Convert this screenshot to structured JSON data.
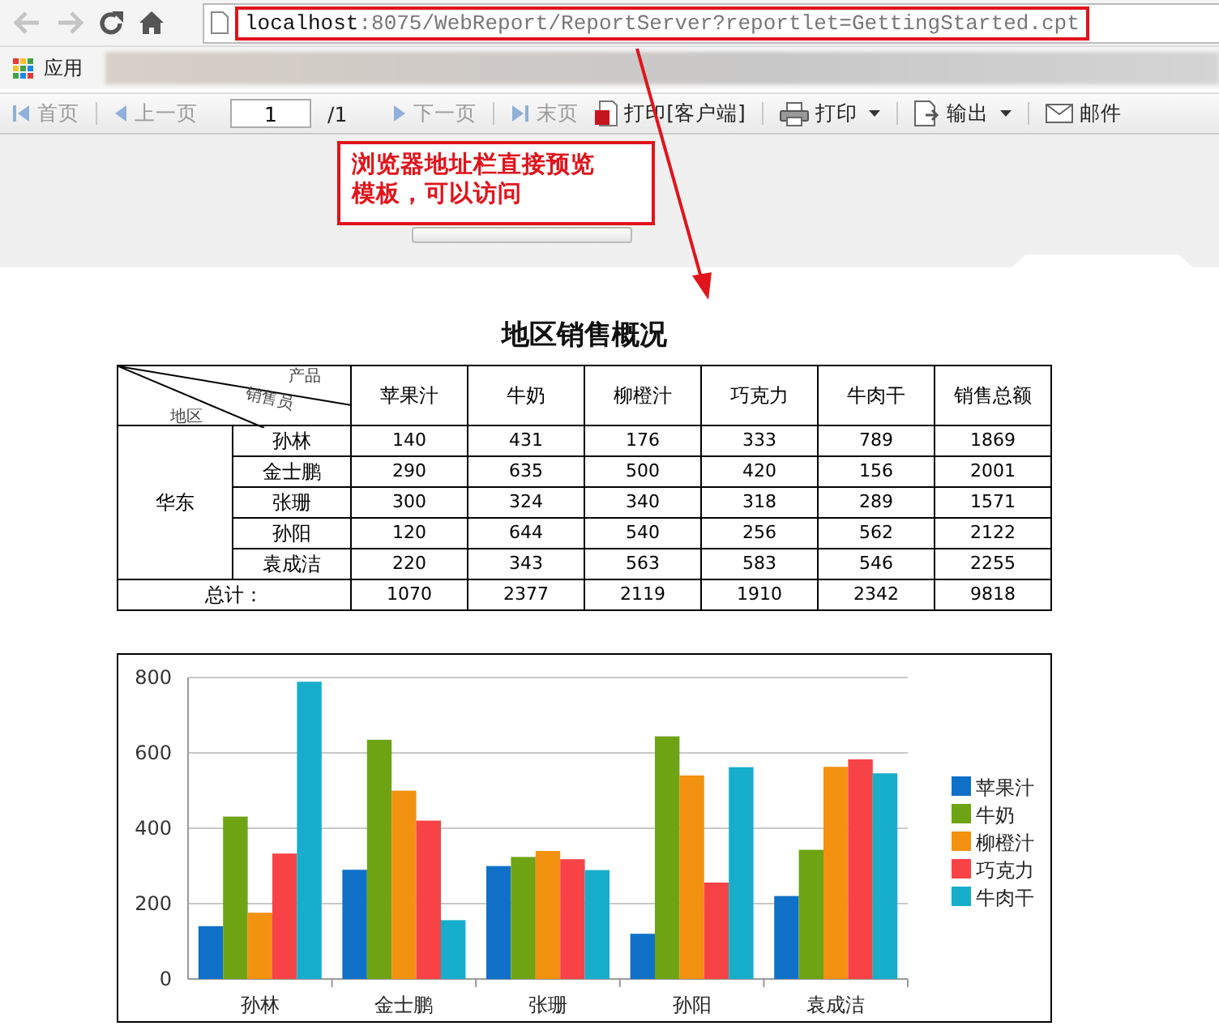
{
  "browser": {
    "url_host": "localhost",
    "url_rest": ":8075/WebReport/ReportServer?reportlet=GettingStarted.cpt",
    "bookmarks": [
      {
        "label": "应用"
      }
    ]
  },
  "toolbar": {
    "buttons": [
      {
        "kind": "first",
        "label": "首页",
        "disabled": true,
        "menu": false
      },
      {
        "kind": "prev",
        "label": "上一页",
        "disabled": true,
        "menu": false
      },
      {
        "kind": "page",
        "total": "/1",
        "value": "1"
      },
      {
        "kind": "next",
        "label": "下一页",
        "disabled": true,
        "menu": false
      },
      {
        "kind": "last",
        "label": "末页",
        "disabled": true,
        "menu": false
      },
      {
        "kind": "pdf",
        "label": "打印[客户端]",
        "disabled": false,
        "menu": false
      },
      {
        "kind": "print",
        "label": "打印",
        "disabled": false,
        "menu": true
      },
      {
        "kind": "export",
        "label": "输出",
        "disabled": false,
        "menu": true
      },
      {
        "kind": "mail",
        "label": "邮件",
        "disabled": false,
        "menu": false
      }
    ]
  },
  "callout": {
    "lines": [
      "浏览器地址栏直接预览",
      "模板，可以访问"
    ]
  },
  "report": {
    "title": "地区销售概况",
    "table": {
      "corner": {
        "top": "产品",
        "middle": "销售员",
        "bottom": "地区"
      },
      "columns": [
        "苹果汁",
        "牛奶",
        "柳橙汁",
        "巧克力",
        "牛肉干",
        "销售总额"
      ],
      "groups": [
        {
          "region": "华东",
          "rows": [
            {
              "name": "孙林",
              "cells": [
                "140",
                "431",
                "176",
                "333",
                "789",
                "1869"
              ]
            },
            {
              "name": "金士鹏",
              "cells": [
                "290",
                "635",
                "500",
                "420",
                "156",
                "2001"
              ]
            },
            {
              "name": "张珊",
              "cells": [
                "300",
                "324",
                "340",
                "318",
                "289",
                "1571"
              ]
            },
            {
              "name": "孙阳",
              "cells": [
                "120",
                "644",
                "540",
                "256",
                "562",
                "2122"
              ]
            },
            {
              "name": "袁成洁",
              "cells": [
                "220",
                "343",
                "563",
                "583",
                "546",
                "2255"
              ]
            }
          ]
        }
      ],
      "total": {
        "label": "总计：",
        "cells": [
          "1070",
          "2377",
          "2119",
          "1910",
          "2342",
          "9818"
        ]
      }
    },
    "chart_data": {
      "type": "bar",
      "categories": [
        "孙林",
        "金士鹏",
        "张珊",
        "孙阳",
        "袁成洁"
      ],
      "ylim": [
        0,
        800
      ],
      "grid": true,
      "legend": true,
      "yticks": [
        0,
        200,
        400,
        600,
        800
      ],
      "series": [
        {
          "name": "苹果汁",
          "color": "#1070c8",
          "values": [
            140,
            290,
            300,
            120,
            220
          ]
        },
        {
          "name": "牛奶",
          "color": "#6ea414",
          "values": [
            431,
            635,
            324,
            644,
            343
          ]
        },
        {
          "name": "柳橙汁",
          "color": "#f39111",
          "values": [
            176,
            500,
            340,
            540,
            563
          ]
        },
        {
          "name": "巧克力",
          "color": "#f84346",
          "values": [
            333,
            420,
            318,
            256,
            583
          ]
        },
        {
          "name": "牛肉干",
          "color": "#16aecb",
          "values": [
            789,
            156,
            289,
            562,
            546
          ]
        }
      ]
    }
  }
}
